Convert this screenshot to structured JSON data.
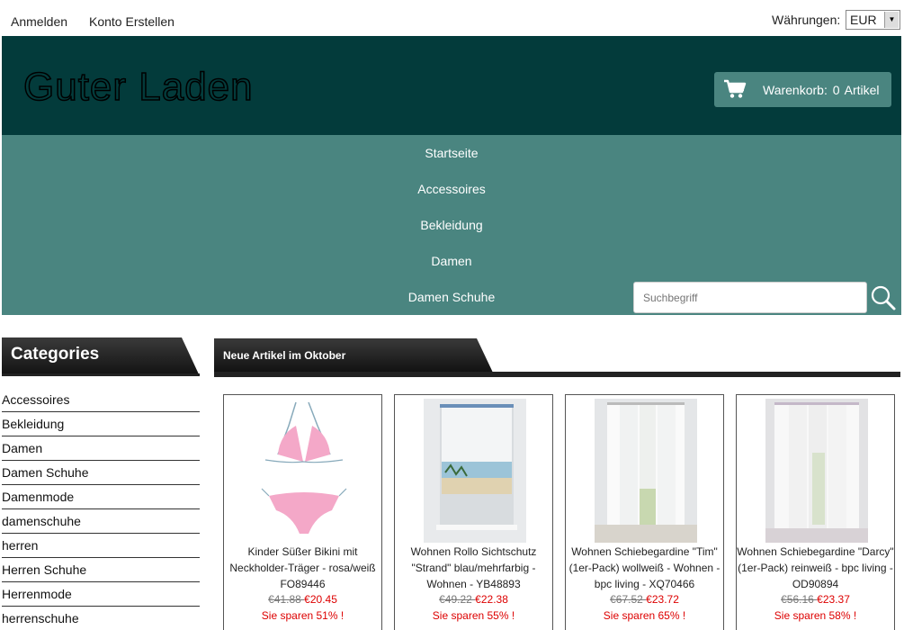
{
  "topbar": {
    "login": "Anmelden",
    "signup": "Konto Erstellen",
    "currency_label": "Währungen:",
    "currency_value": "EUR"
  },
  "header": {
    "logo": "Guter Laden",
    "cart": "Warenkorb:  0  Artikel"
  },
  "nav": {
    "items": [
      "Startseite",
      "Accessoires",
      "Bekleidung",
      "Damen",
      "Damen Schuhe"
    ]
  },
  "search": {
    "placeholder": "Suchbegriff"
  },
  "sidebar": {
    "title": "Categories",
    "items": [
      "Accessoires",
      "Bekleidung",
      "Damen",
      "Damen Schuhe",
      "Damenmode",
      "damenschuhe",
      "herren",
      "Herren Schuhe",
      "Herrenmode",
      "herrenschuhe"
    ]
  },
  "main": {
    "section_title": "Neue Artikel im Oktober",
    "products": [
      {
        "name": "Kinder Süßer Bikini mit Neckholder-Träger - rosa/weiß FO89446",
        "old_price": "€41.88 ",
        "new_price": "€20.45",
        "save": "Sie sparen 51% !"
      },
      {
        "name": "Wohnen Rollo Sichtschutz \"Strand\" blau/mehrfarbig - Wohnen - YB48893",
        "old_price": "€49.22 ",
        "new_price": "€22.38",
        "save": "Sie sparen 55% !"
      },
      {
        "name": "Wohnen Schiebegardine \"Tim\" (1er-Pack) wollweiß - Wohnen - bpc living - XQ70466",
        "old_price": "€67.52 ",
        "new_price": "€23.72",
        "save": "Sie sparen 65% !"
      },
      {
        "name": "Wohnen Schiebegardine \"Darcy\" (1er-Pack) reinweiß - bpc living - OD90894",
        "old_price": "€56.16 ",
        "new_price": "€23.37",
        "save": "Sie sparen 58% !"
      }
    ]
  },
  "colors": {
    "header_bg": "#033b3b",
    "nav_bg": "#4a8580",
    "sale_red": "#dd0000"
  }
}
